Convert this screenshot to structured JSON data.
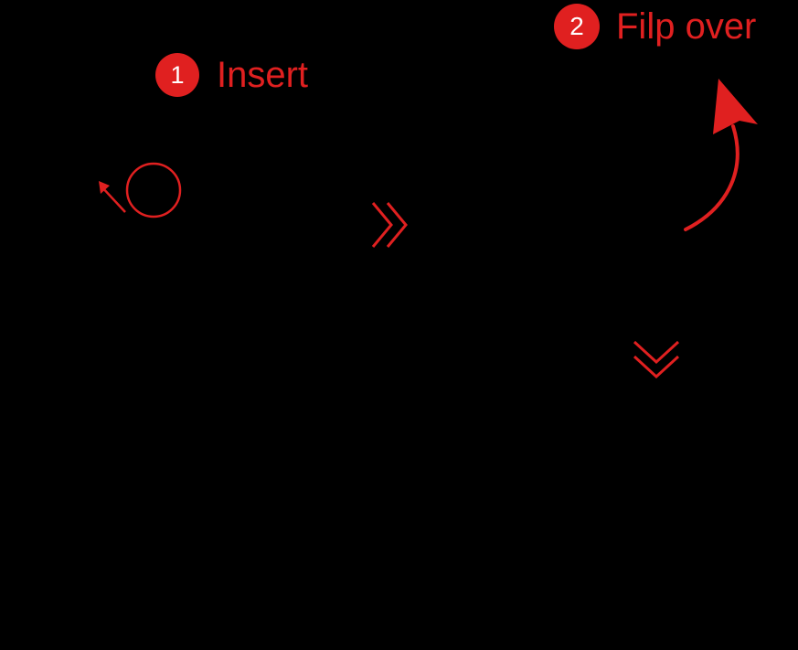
{
  "accent_color": "#e02020",
  "background_color": "#000000",
  "steps": [
    {
      "number": "1",
      "label": "Insert"
    },
    {
      "number": "2",
      "label": "Filp over"
    }
  ],
  "icons": {
    "rotate": "rotate-ring-icon",
    "next_right": "double-chevron-right-icon",
    "next_down": "double-chevron-down-icon",
    "flip": "curved-arrow-up-icon"
  }
}
